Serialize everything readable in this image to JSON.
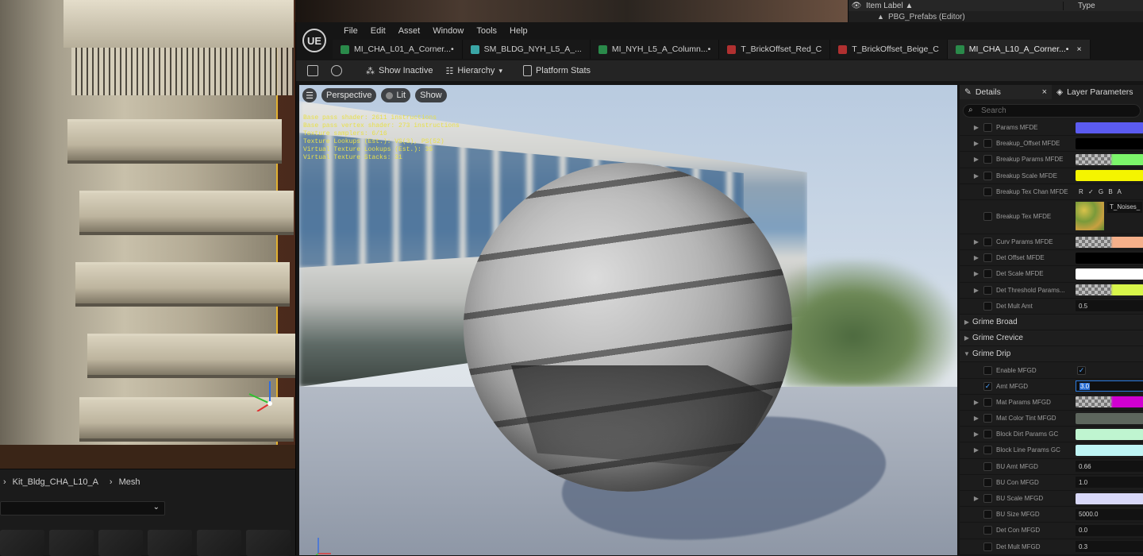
{
  "outliner": {
    "col_item_label": "Item Label ▲",
    "col_type": "Type",
    "row_prefabs": "PBG_Prefabs (Editor)"
  },
  "content_browser": {
    "path": [
      "Kit_Bldg_CHA_L10_A",
      "Mesh"
    ]
  },
  "editor": {
    "logo": "UE",
    "menus": [
      "File",
      "Edit",
      "Asset",
      "Window",
      "Tools",
      "Help"
    ],
    "tabs": [
      {
        "label": "MI_CHA_L01_A_Corner...•",
        "icon_color": "#2a8a4a"
      },
      {
        "label": "SM_BLDG_NYH_L5_A_...",
        "icon_color": "#3aa6a6"
      },
      {
        "label": "MI_NYH_L5_A_Column...•",
        "icon_color": "#2a8a4a"
      },
      {
        "label": "T_BrickOffset_Red_C",
        "icon_color": "#b03030"
      },
      {
        "label": "T_BrickOffset_Beige_C",
        "icon_color": "#b03030"
      },
      {
        "label": "MI_CHA_L10_A_Corner...•",
        "icon_color": "#2a8a4a",
        "active": true
      }
    ],
    "close_glyph": "×",
    "toolbar": {
      "show_inactive": "Show Inactive",
      "hierarchy": "Hierarchy",
      "platform_stats": "Platform Stats"
    }
  },
  "viewport": {
    "menu_icon": "hamburger-icon",
    "perspective": "Perspective",
    "lit": "Lit",
    "show": "Show",
    "stats": [
      "Base pass shader: 2611 instructions",
      "Base pass vertex shader: 273 instructions",
      "Texture samplers: 6/16",
      "Texture Lookups (Est.): VS(3), PS(52)",
      "Virtual Texture Lookups (Est.): 35",
      "Virtual Texture Stacks: 31"
    ]
  },
  "details": {
    "tab_details": "Details",
    "tab_close": "×",
    "tab_layer": "Layer Parameters",
    "search_placeholder": "Search",
    "rows": [
      {
        "kind": "prop",
        "arrow": true,
        "name": "Params MFDE",
        "value_type": "color",
        "color": "#5b5bf0"
      },
      {
        "kind": "prop",
        "arrow": true,
        "name": "Breakup_Offset MFDE",
        "value_type": "color",
        "color": "#000000"
      },
      {
        "kind": "prop",
        "arrow": true,
        "name": "Breakup Params MFDE",
        "value_type": "gradient",
        "color": "#7cf56a"
      },
      {
        "kind": "prop",
        "arrow": true,
        "name": "Breakup Scale MFDE",
        "value_type": "color",
        "color": "#f5f500"
      },
      {
        "kind": "prop",
        "arrow": false,
        "name": "Breakup Tex Chan MFDE",
        "value_type": "channels",
        "text": "R ✓  G     B     A"
      },
      {
        "kind": "prop",
        "arrow": false,
        "name": "Breakup Tex MFDE",
        "value_type": "texture",
        "text": "T_Noises_",
        "tall": true
      },
      {
        "kind": "prop",
        "arrow": true,
        "name": "Curv Params MFDE",
        "value_type": "gradient",
        "color": "#f5b08a"
      },
      {
        "kind": "prop",
        "arrow": true,
        "name": "Det Offset MFDE",
        "value_type": "color",
        "color": "#000000"
      },
      {
        "kind": "prop",
        "arrow": true,
        "name": "Det Scale MFDE",
        "value_type": "color",
        "color": "#ffffff"
      },
      {
        "kind": "prop",
        "arrow": true,
        "name": "Det Threshold Params...",
        "value_type": "gradient",
        "color": "#d8f54a"
      },
      {
        "kind": "prop",
        "arrow": false,
        "name": "Det Mult Amt",
        "value_type": "text",
        "text": "0.5"
      },
      {
        "kind": "cat",
        "expanded": false,
        "name": "Grime Broad"
      },
      {
        "kind": "cat",
        "expanded": false,
        "name": "Grime Crevice"
      },
      {
        "kind": "cat",
        "expanded": true,
        "name": "Grime Drip"
      },
      {
        "kind": "prop",
        "arrow": false,
        "name": "Enable MFGD",
        "value_type": "check",
        "text": "✓"
      },
      {
        "kind": "prop",
        "arrow": false,
        "checked": true,
        "name": "Amt MFGD",
        "value_type": "edit",
        "text": "3.0"
      },
      {
        "kind": "prop",
        "arrow": true,
        "name": "Mat Params MFGD",
        "value_type": "gradient",
        "color": "#d000d0"
      },
      {
        "kind": "prop",
        "arrow": true,
        "name": "Mat Color Tint MFGD",
        "value_type": "color",
        "color": "#5d665d"
      },
      {
        "kind": "prop",
        "arrow": true,
        "name": "Block Dirt Params GC",
        "value_type": "color",
        "color": "#bff5d0"
      },
      {
        "kind": "prop",
        "arrow": true,
        "name": "Block Line Params GC",
        "value_type": "color",
        "color": "#bff5f5"
      },
      {
        "kind": "prop",
        "arrow": false,
        "name": "BU Amt MFGD",
        "value_type": "text",
        "text": "0.66"
      },
      {
        "kind": "prop",
        "arrow": false,
        "name": "BU Con MFGD",
        "value_type": "text",
        "text": "1.0"
      },
      {
        "kind": "prop",
        "arrow": true,
        "name": "BU Scale MFGD",
        "value_type": "color",
        "color": "#d8d8f8"
      },
      {
        "kind": "prop",
        "arrow": false,
        "name": "BU Size MFGD",
        "value_type": "text",
        "text": "5000.0"
      },
      {
        "kind": "prop",
        "arrow": false,
        "name": "Det Con MFGD",
        "value_type": "text",
        "text": "0.0"
      },
      {
        "kind": "prop",
        "arrow": false,
        "name": "Det Mult MFGD",
        "value_type": "text",
        "text": "0.3"
      }
    ]
  }
}
